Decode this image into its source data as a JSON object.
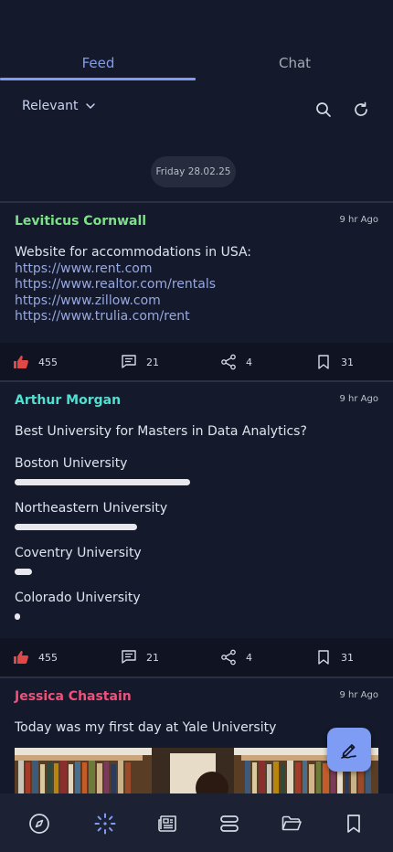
{
  "tabs": [
    {
      "label": "Feed",
      "active": true
    },
    {
      "label": "Chat",
      "active": false
    }
  ],
  "filter": {
    "sort_label": "Relevant"
  },
  "date_separator": "Friday 28.02.25",
  "colors": {
    "accent": "#7f9cf5",
    "background": "#141a2b",
    "link": "#98a8e0",
    "like": "#e04848"
  },
  "posts": [
    {
      "author": "Leviticus Cornwall",
      "author_color": "#7ee08a",
      "time": "9 hr Ago",
      "text": "Website for accommodations in USA:",
      "links": [
        "https://www.rent.com",
        "https://www.realtor.com/rentals",
        "https://www.zillow.com",
        "https://www.trulia.com/rent"
      ],
      "likes": "455",
      "comments": "21",
      "shares": "4",
      "saves": "31"
    },
    {
      "author": "Arthur Morgan",
      "author_color": "#4fe0d2",
      "time": "9 hr Ago",
      "text": "Best University for Masters in Data Analytics?",
      "poll": [
        {
          "option": "Boston University",
          "share": 1.0
        },
        {
          "option": "Northeastern University",
          "share": 0.7
        },
        {
          "option": "Coventry University",
          "share": 0.1
        },
        {
          "option": "Colorado University",
          "share": 0.03
        }
      ],
      "likes": "455",
      "comments": "21",
      "shares": "4",
      "saves": "31"
    },
    {
      "author": "Jessica Chastain",
      "author_color": "#f0507a",
      "time": "9 hr Ago",
      "text": "Today was my first day at Yale University"
    }
  ],
  "icons": {
    "like": "thumbs-up-icon",
    "comment": "comment-icon",
    "share": "share-icon",
    "save": "bookmark-icon",
    "fab": "compose-icon",
    "nav": [
      "compass-icon",
      "sparkle-icon",
      "news-icon",
      "stack-icon",
      "folder-icon",
      "bookmark-icon"
    ]
  }
}
